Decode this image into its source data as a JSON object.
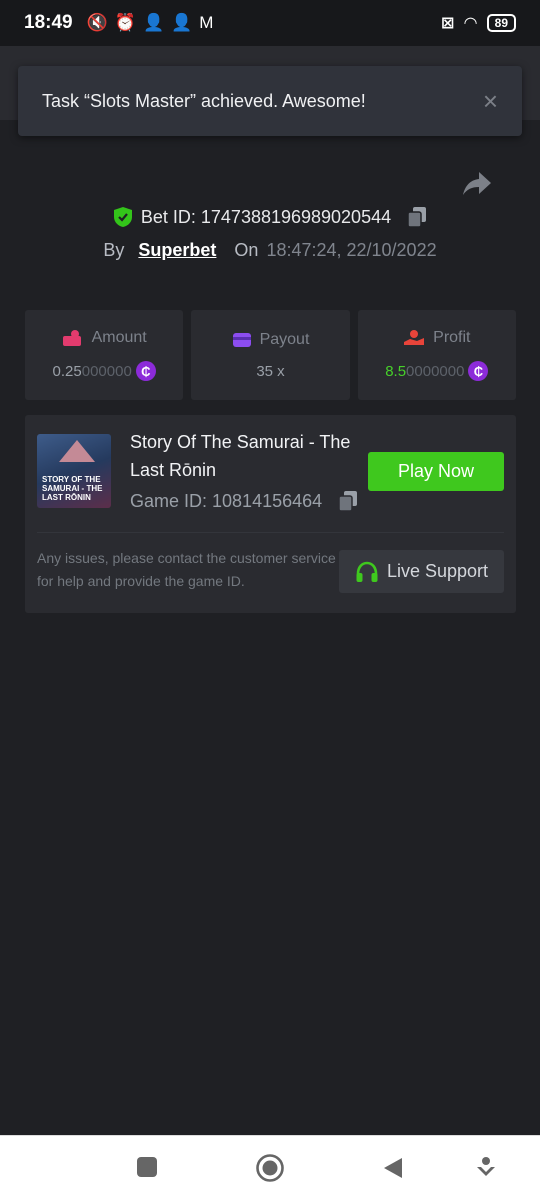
{
  "status_bar": {
    "time": "18:49",
    "battery": "89",
    "icons": [
      "mute-icon",
      "alarm-icon",
      "person-add-icon",
      "person-add-icon",
      "gmail-icon",
      "sim-error-icon",
      "wifi-icon",
      "battery-icon"
    ]
  },
  "toast": {
    "message": "Task “Slots Master” achieved. Awesome!",
    "close": "×"
  },
  "bet": {
    "id_label": "Bet ID: 1747388196989020544",
    "by_label": "By",
    "user": "Superbet",
    "on_label": "On",
    "datetime": "18:47:24, 22/10/2022"
  },
  "stats": {
    "amount": {
      "label": "Amount",
      "value_main": "0.25",
      "value_dim": "000000"
    },
    "payout": {
      "label": "Payout",
      "value": "35 x"
    },
    "profit": {
      "label": "Profit",
      "value_main": "8.5",
      "value_dim": "0000000"
    },
    "coin_glyph": "₵"
  },
  "game": {
    "title": "Story Of The Samurai - The Last Rōnin",
    "id_label": "Game ID: 10814156464",
    "thumb_text": "STORY OF THE SAMURAI - THE LAST RŌNIN",
    "play_label": "Play Now",
    "issues_text": "Any issues, please contact the customer service for help and provide the game ID.",
    "support_label": "Live Support"
  },
  "colors": {
    "background": "#1f2024",
    "card": "#2a2b30",
    "accent_green": "#3fc81e",
    "coin_purple": "#8c2bd9"
  }
}
